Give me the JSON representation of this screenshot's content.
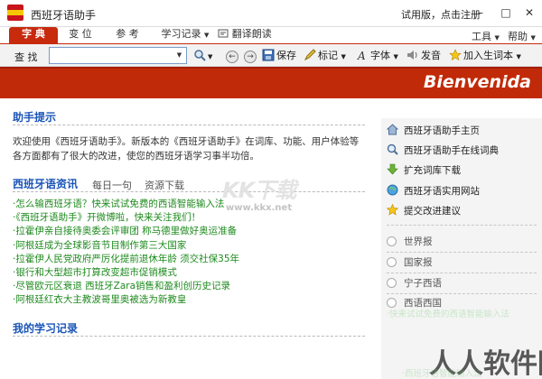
{
  "window": {
    "title": "西班牙语助手",
    "trial_text": "试用版，点击注册"
  },
  "tabs": [
    {
      "label": "字 典",
      "active": true
    },
    {
      "label": "变 位",
      "active": false
    },
    {
      "label": "参 考",
      "active": false
    },
    {
      "label": "学习记录",
      "active": false
    },
    {
      "label": "翻译朗读",
      "active": false
    }
  ],
  "menu_right": {
    "tools": "工具",
    "help": "帮助"
  },
  "toolbar": {
    "find_label": "查 找",
    "search_value": "",
    "save_label": "保存",
    "mark_label": "标记",
    "font_label": "字体",
    "speak_label": "发音",
    "add_vocab_label": "加入生词本"
  },
  "banner": {
    "text": "Bienvenida"
  },
  "tips": {
    "heading": "助手提示",
    "text": "欢迎使用《西班牙语助手》。新版本的《西班牙语助手》在词库、功能、用户体验等各方面都有了很大的改进，使您的西班牙语学习事半功倍。"
  },
  "news": {
    "heading": "西班牙语资讯",
    "subtabs": [
      "每日一句",
      "资源下载"
    ],
    "items": [
      "·怎么输西班牙语？快来试试免费的西语智能输入法",
      "·《西班牙语助手》开微博啦，快来关注我们！",
      "·拉霍伊亲自接待奥委会评审团 称马德里做好奥运准备",
      "·阿根廷成为全球影音节目制作第三大国家",
      "·拉霍伊人民党政府严厉化提前退休年龄 须交社保35年",
      "·银行和大型超市打算改变超市促销模式",
      "·尽管欧元区衰退 西班牙Zara销售和盈利创历史记录",
      "·阿根廷红衣大主教波哥里奥被选为新教皇"
    ]
  },
  "records": {
    "heading": "我的学习记录"
  },
  "side": {
    "links": [
      {
        "label": "西班牙语助手主页",
        "icon": "home-icon"
      },
      {
        "label": "西班牙语助手在线词典",
        "icon": "search-icon"
      },
      {
        "label": "扩充词库下载",
        "icon": "download-arrow-icon"
      },
      {
        "label": "西班牙语实用网站",
        "icon": "globe-icon"
      },
      {
        "label": "提交改进建议",
        "icon": "star-icon"
      }
    ],
    "radios": [
      "世界报",
      "国家报",
      "宁子西语",
      "西语西国"
    ]
  },
  "watermarks": {
    "brand": "KK下载",
    "url": "www.kkx.net",
    "faint_line": "·快来试试免费的西语智能输入法",
    "site_logo": "人人软件园",
    "faint_line2": "·西班牙语智能输入法"
  },
  "colors": {
    "accent_red": "#c12a08",
    "heading_blue": "#1a55b8",
    "news_green": "#1e8a1e"
  }
}
